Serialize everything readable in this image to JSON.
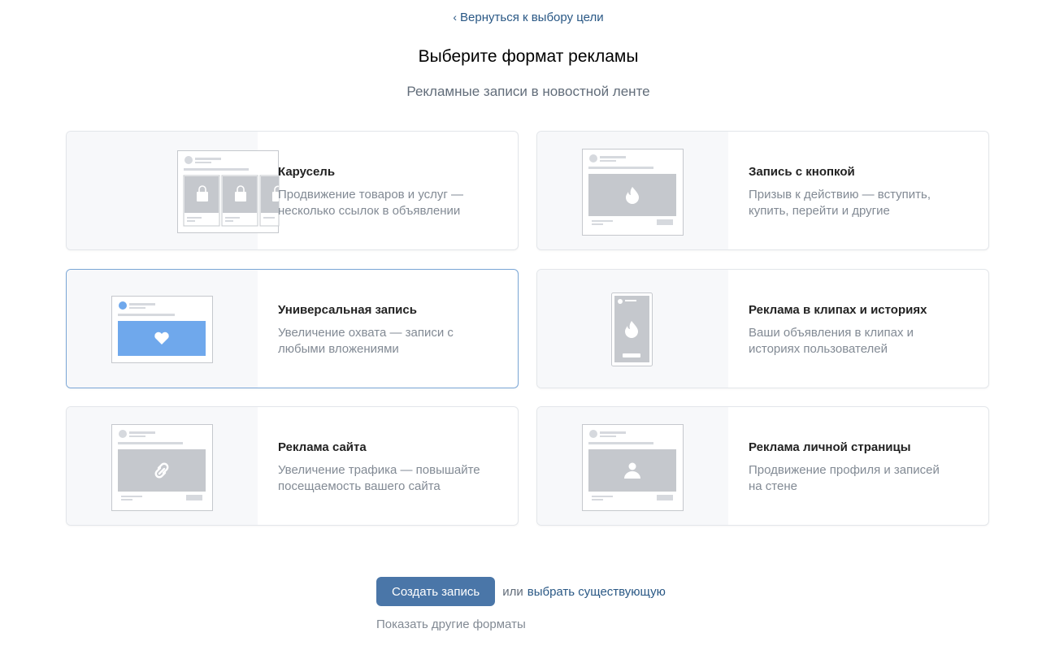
{
  "nav": {
    "back_label": "Вернуться к выбору цели"
  },
  "header": {
    "title": "Выберите формат рекламы",
    "section": "Рекламные записи в новостной ленте"
  },
  "formats": [
    {
      "title": "Карусель",
      "desc_line1": "Продвижение товаров и услуг —",
      "desc_line2": "несколько ссылок в объявлении",
      "icon": "bag-icon"
    },
    {
      "title": "Запись с кнопкой",
      "desc_line1": "Призыв к действию — вступить,",
      "desc_line2": "купить, перейти и другие",
      "icon": "flame-icon"
    },
    {
      "title": "Универсальная запись",
      "desc_line1": "Увеличение охвата — записи с",
      "desc_line2": "любыми вложениями",
      "icon": "heart-icon",
      "selected": true
    },
    {
      "title": "Реклама в клипах и историях",
      "desc_line1": "Ваши объявления в клипах и",
      "desc_line2": "историях пользователей",
      "icon": "flame-icon"
    },
    {
      "title": "Реклама сайта",
      "desc_line1": "Увеличение трафика — повышайте",
      "desc_line2": "посещаемость вашего сайта",
      "icon": "link-icon"
    },
    {
      "title": "Реклама личной страницы",
      "desc_line1": "Продвижение профиля и записей",
      "desc_line2": "на стене",
      "icon": "user-icon"
    }
  ],
  "actions": {
    "create_label": "Создать запись",
    "or_label": "или",
    "choose_existing_label": "выбрать существующую",
    "other_formats_label": "Показать другие форматы"
  },
  "colors": {
    "accent": "#4a76a8",
    "link": "#2a5885",
    "selected_border": "#7aa6d6",
    "highlight_preview": "#6fa8ec",
    "placeholder_gray": "#c5c8cd"
  }
}
